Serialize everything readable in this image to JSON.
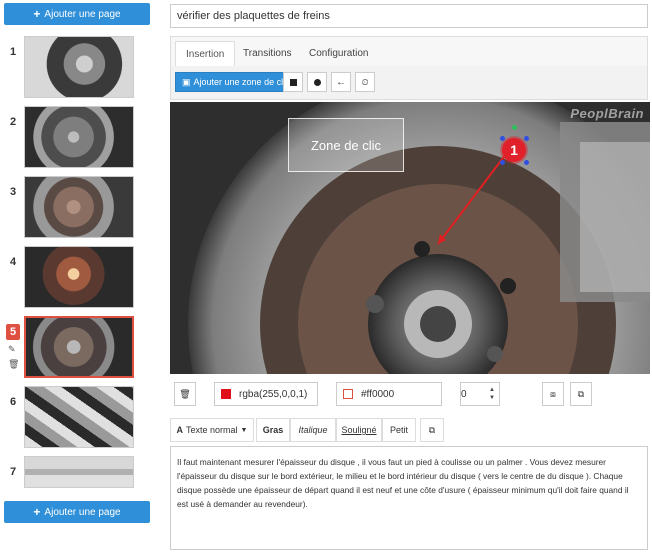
{
  "sidebar": {
    "add_page_label": "Ajouter une page",
    "add_page_label_bottom": "Ajouter une page",
    "pages": [
      {
        "number": "1"
      },
      {
        "number": "2"
      },
      {
        "number": "3"
      },
      {
        "number": "4"
      },
      {
        "number": "5",
        "active": true
      },
      {
        "number": "6"
      },
      {
        "number": "7"
      }
    ]
  },
  "title_input": {
    "value": "vérifier des plaquettes de freins"
  },
  "tabs": [
    {
      "label": "Insertion",
      "active": true
    },
    {
      "label": "Transitions"
    },
    {
      "label": "Configuration"
    }
  ],
  "toolbar": {
    "add_zone_label": "Ajouter une zone de clic",
    "icons": [
      "square-icon",
      "circle-icon",
      "arrow-icon",
      "clock-icon"
    ]
  },
  "canvas": {
    "watermark": "PeoplBrain",
    "click_zone_label": "Zone de clic",
    "marker_number": "1",
    "colors": {
      "marker": "#e0202a",
      "arrow": "#e02020"
    }
  },
  "properties": {
    "fill_color_value": "rgba(255,0,0,1)",
    "fill_swatch": "#e0101a",
    "border_color_value": "#ff0000",
    "border_swatch": "#ffffff",
    "border_swatch_outline": "#e05040",
    "border_width_value": "0"
  },
  "editor": {
    "text_style_label": "Texte normal",
    "bold_label": "Gras",
    "italic_label": "Italique",
    "underline_label": "Souligné",
    "small_label": "Petit",
    "text": "Il faut maintenant mesurer l'épaisseur du disque , il vous faut un pied à coulisse ou un palmer . Vous devez mesurer l'épaisseur du disque sur le bord extérieur, le milieu et le bord intérieur du disque ( vers le centre de du disque ). Chaque disque possède une épaisseur de départ quand il est neuf et une côte d'usure ( épaisseur minimum qu'il doit faire quand il est usé à demander au revendeur)."
  },
  "accent_color": "#2f8fd8",
  "active_color": "#e05040"
}
